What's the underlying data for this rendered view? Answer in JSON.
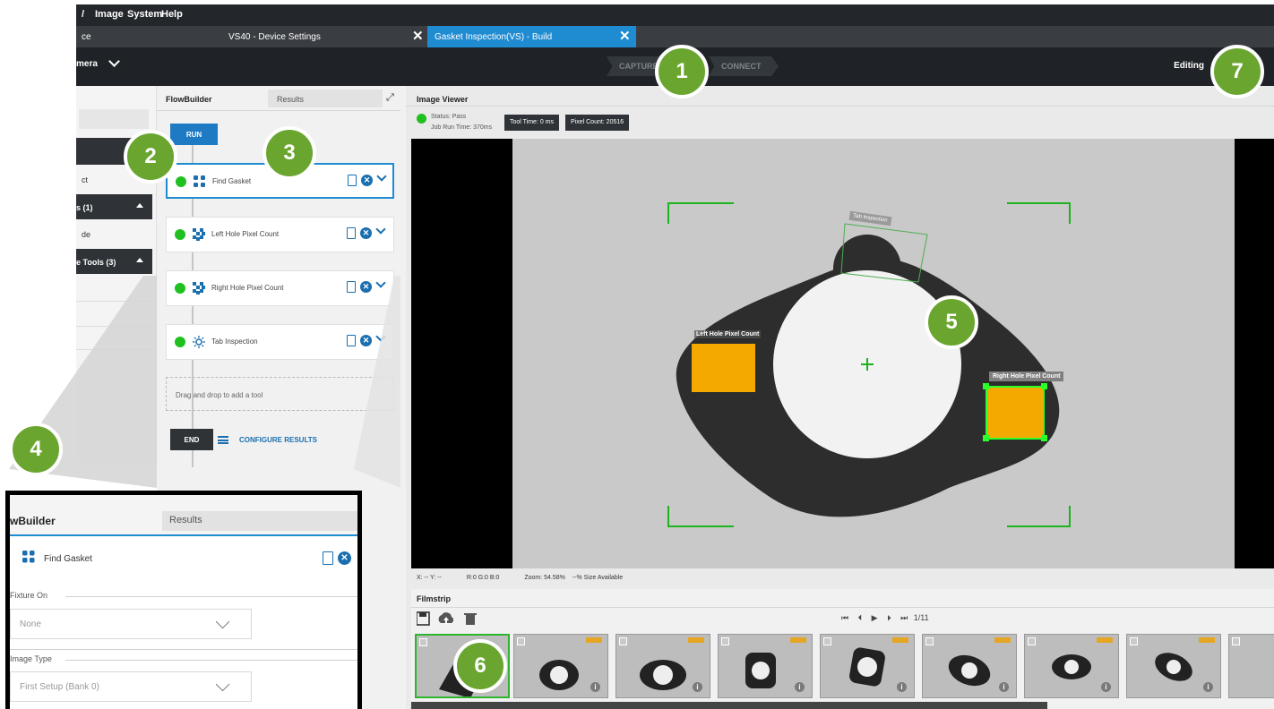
{
  "menu": {
    "items": [
      "Image",
      "System",
      "Help"
    ]
  },
  "tabs": [
    {
      "label": "ce"
    },
    {
      "label": "VS40 - Device Settings"
    },
    {
      "label": "Gasket Inspection(VS) - Build",
      "active": true
    }
  ],
  "toolbar": {
    "camera_label": "mera",
    "steps": [
      "CAPTURE",
      "CONNECT"
    ],
    "mode": "Editing"
  },
  "left_panel": {
    "row1": "ct",
    "group1": "s (1)",
    "row2": "de",
    "group2": "e Tools (3)"
  },
  "flowbuilder": {
    "tab_label": "FlowBuilder",
    "results_tab": "Results",
    "run_label": "RUN",
    "tools": [
      {
        "name": "Find Gasket",
        "icon": "pattern-icon",
        "status": "pass"
      },
      {
        "name": "Left Hole Pixel Count",
        "icon": "checker-icon",
        "status": "pass"
      },
      {
        "name": "Right Hole Pixel Count",
        "icon": "checker-icon",
        "status": "pass"
      },
      {
        "name": "Tab Inspection",
        "icon": "sun-icon",
        "status": "pass"
      }
    ],
    "dropzone": "Drag and drop to add a tool",
    "end_label": "END",
    "configure_label": "CONFIGURE RESULTS"
  },
  "viewer": {
    "title": "Image Viewer",
    "status_label": "Status:",
    "status_value": "Pass",
    "job_run_label": "Job Run Time:",
    "job_run_value": "370ms",
    "tool_time": "Tool Time: 0 ms",
    "pixel_count": "Pixel Count: 20516",
    "overlays": {
      "tab": "Tab Inspection",
      "left": "Left Hole Pixel Count",
      "right": "Right Hole Pixel Count"
    },
    "footer": {
      "xy": "X: -- Y: --",
      "rgb": "R:0 G:0 B:0",
      "zoom": "Zoom: 54.58%",
      "size": "--% Size Available"
    }
  },
  "filmstrip": {
    "title": "Filmstrip",
    "counter": "1/11"
  },
  "callout": {
    "tab1": "wBuilder",
    "tab2": "Results",
    "tool_name": "Find Gasket",
    "fixture_label": "Fixture On",
    "fixture_value": "None",
    "image_type_label": "Image Type",
    "image_type_value": "First Setup (Bank 0)"
  },
  "callout_numbers": [
    "1",
    "2",
    "3",
    "4",
    "5",
    "6",
    "7"
  ],
  "colors": {
    "accent_green": "#6aa62f",
    "tab_blue": "#1f8bd1",
    "pass_green": "#20c020",
    "roi_orange": "#f4a900"
  }
}
